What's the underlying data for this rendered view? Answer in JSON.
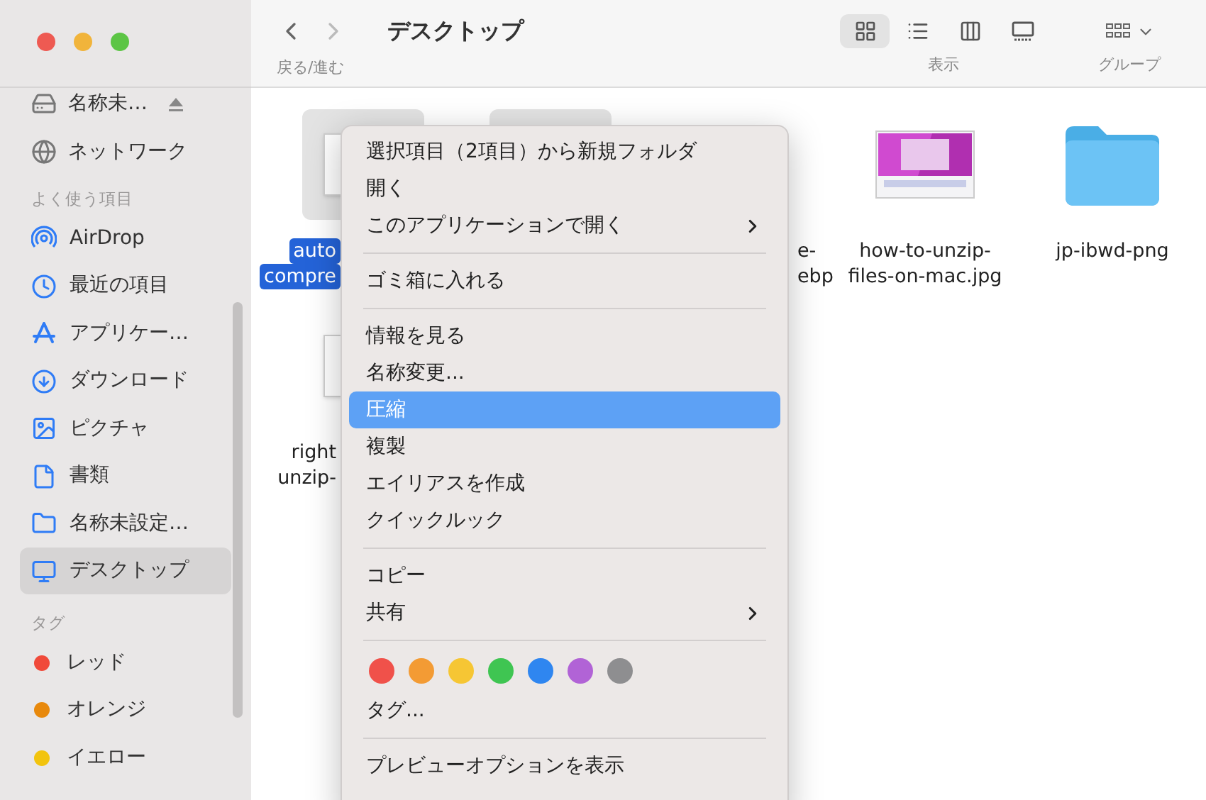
{
  "window": {
    "title": "デスクトップ",
    "nav_label": "戻る/進む",
    "view_label": "表示",
    "group_label": "グループ"
  },
  "view_modes": [
    {
      "selected": true
    },
    {
      "selected": false
    },
    {
      "selected": false
    },
    {
      "selected": false
    }
  ],
  "sidebar": {
    "top_items": [
      {
        "label": "名称未…",
        "ejectable": true
      },
      {
        "label": "ネットワーク",
        "ejectable": false
      }
    ],
    "favorites": {
      "heading": "よく使う項目",
      "items": [
        {
          "label": "AirDrop",
          "selected": false
        },
        {
          "label": "最近の項目",
          "selected": false
        },
        {
          "label": "アプリケー…",
          "selected": false
        },
        {
          "label": "ダウンロード",
          "selected": false
        },
        {
          "label": "ピクチャ",
          "selected": false
        },
        {
          "label": "書類",
          "selected": false
        },
        {
          "label": "名称未設定…",
          "selected": false
        },
        {
          "label": "デスクトップ",
          "selected": true
        }
      ]
    },
    "tags": {
      "heading": "タグ",
      "items": [
        {
          "label": "レッド",
          "color": "#f04a3a"
        },
        {
          "label": "オレンジ",
          "color": "#e8890c"
        },
        {
          "label": "イエロー",
          "color": "#f2c40e"
        }
      ]
    }
  },
  "files": [
    [
      {
        "kind": "cut",
        "lines": [
          "auto",
          "compre"
        ],
        "selected": true
      },
      {
        "kind": "hidden",
        "selected": true
      },
      {
        "kind": "tail",
        "lines": [
          "e-",
          "ebp"
        ],
        "selected": false
      },
      {
        "kind": "image",
        "lines": [
          "how-to-unzip-",
          "files-on-mac.jpg"
        ],
        "selected": false
      },
      {
        "kind": "folder",
        "lines": [
          "jp-ibwd-png"
        ],
        "selected": false
      }
    ],
    [
      {
        "kind": "cut",
        "lines": [
          "right",
          "unzip-"
        ],
        "selected": false
      }
    ]
  ],
  "context_menu": [
    {
      "kind": "item",
      "label": "選択項目（2項目）から新規フォルダ",
      "selected": false,
      "submenu": false
    },
    {
      "kind": "item",
      "label": "開く",
      "selected": false,
      "submenu": false
    },
    {
      "kind": "item",
      "label": "このアプリケーションで開く",
      "selected": false,
      "submenu": true
    },
    {
      "kind": "separator"
    },
    {
      "kind": "item",
      "label": "ゴミ箱に入れる",
      "selected": false,
      "submenu": false
    },
    {
      "kind": "separator"
    },
    {
      "kind": "item",
      "label": "情報を見る",
      "selected": false,
      "submenu": false
    },
    {
      "kind": "item",
      "label": "名称変更...",
      "selected": false,
      "submenu": false
    },
    {
      "kind": "item",
      "label": "圧縮",
      "selected": true,
      "submenu": false
    },
    {
      "kind": "item",
      "label": "複製",
      "selected": false,
      "submenu": false
    },
    {
      "kind": "item",
      "label": "エイリアスを作成",
      "selected": false,
      "submenu": false
    },
    {
      "kind": "item",
      "label": "クイックルック",
      "selected": false,
      "submenu": false
    },
    {
      "kind": "separator"
    },
    {
      "kind": "item",
      "label": "コピー",
      "selected": false,
      "submenu": false
    },
    {
      "kind": "item",
      "label": "共有",
      "selected": false,
      "submenu": true
    },
    {
      "kind": "separator"
    },
    {
      "kind": "colors",
      "colors": [
        {
          "color": "#f0514a"
        },
        {
          "color": "#f39b34"
        },
        {
          "color": "#f6c634"
        },
        {
          "color": "#3fc552"
        },
        {
          "color": "#2f86f0"
        },
        {
          "color": "#b163d6"
        },
        {
          "color": "#8e8e90"
        }
      ]
    },
    {
      "kind": "item",
      "label": "タグ...",
      "selected": false,
      "submenu": false
    },
    {
      "kind": "separator"
    },
    {
      "kind": "item",
      "label": "プレビューオプションを表示",
      "selected": false,
      "submenu": false
    }
  ]
}
